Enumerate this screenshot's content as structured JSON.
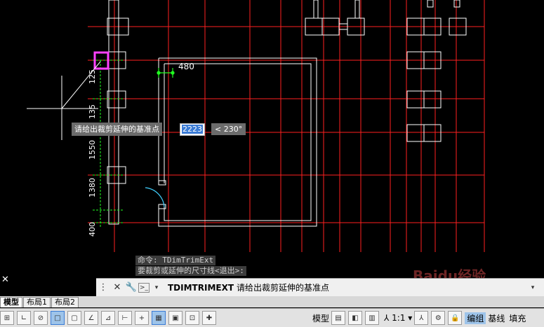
{
  "dimension_label": "480",
  "tooltip": {
    "prompt": "请给出裁剪延伸的基准点",
    "input_value": "2223",
    "angle": "< 230°"
  },
  "history": [
    "命令: TDimTrimExt",
    "要裁剪或延伸的尺寸线<退出>:"
  ],
  "command_line": {
    "command": "TDIMTRIMEXT",
    "prompt": "请给出裁剪延伸的基准点"
  },
  "tabs": [
    "模型",
    "布局1",
    "布局2"
  ],
  "status": {
    "model_label": "模型",
    "scale": "1:1",
    "edit_group": "编组",
    "baseline": "基线",
    "fill": "填充"
  },
  "watermark": "Baidu经验",
  "colors": {
    "grid": "#ff2020",
    "wall": "#ffffff",
    "dimension": "#20ff20",
    "selection": "#ff40ff",
    "door_arc": "#40d0ff"
  }
}
